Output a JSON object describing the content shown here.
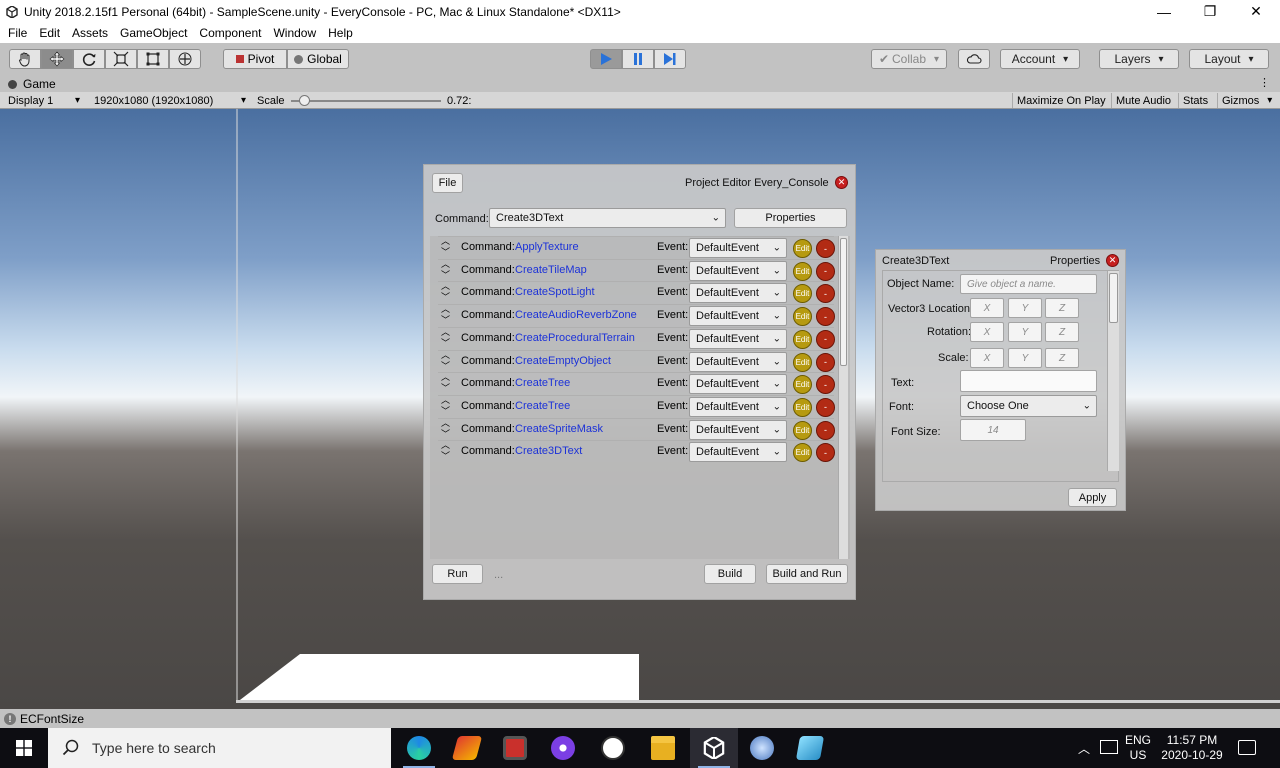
{
  "window": {
    "title": "Unity 2018.2.15f1 Personal (64bit) - SampleScene.unity - EveryConsole - PC, Mac & Linux Standalone* <DX11>",
    "minimize": "—",
    "maximize": "❐",
    "close": "✕"
  },
  "menubar": [
    "File",
    "Edit",
    "Assets",
    "GameObject",
    "Component",
    "Window",
    "Help"
  ],
  "toolbar": {
    "pivot": "Pivot",
    "global": "Global",
    "collab": "Collab",
    "account": "Account",
    "layers": "Layers",
    "layout": "Layout"
  },
  "game": {
    "tab": "Game",
    "display": "Display 1",
    "resolution": "1920x1080 (1920x1080)",
    "scale_label": "Scale",
    "scale_value": "0.72:",
    "scale_level": 0.05,
    "maximize_on_play": "Maximize On Play",
    "mute_audio": "Mute Audio",
    "stats": "Stats",
    "gizmos": "Gizmos"
  },
  "editor": {
    "file_button": "File",
    "title": "Project Editor Every_Console",
    "command_label": "Command:",
    "command_selected": "Create3DText",
    "properties_button": "Properties",
    "row_command_label": "Command:",
    "row_event_label": "Event:",
    "edit_label": "Edit",
    "delete_label": "-",
    "rows": [
      {
        "command": "ApplyTexture",
        "event": "DefaultEvent"
      },
      {
        "command": "CreateTileMap",
        "event": "DefaultEvent"
      },
      {
        "command": "CreateSpotLight",
        "event": "DefaultEvent"
      },
      {
        "command": "CreateAudioReverbZone",
        "event": "DefaultEvent"
      },
      {
        "command": "CreateProceduralTerrain",
        "event": "DefaultEvent"
      },
      {
        "command": "CreateEmptyObject",
        "event": "DefaultEvent"
      },
      {
        "command": "CreateTree",
        "event": "DefaultEvent"
      },
      {
        "command": "CreateTree",
        "event": "DefaultEvent"
      },
      {
        "command": "CreateSpriteMask",
        "event": "DefaultEvent"
      },
      {
        "command": "Create3DText",
        "event": "DefaultEvent"
      }
    ],
    "run_button": "Run",
    "ellipsis": "...",
    "build_button": "Build",
    "build_and_run_button": "Build and Run"
  },
  "properties": {
    "title": "Create3DText",
    "header": "Properties",
    "object_name_label": "Object Name:",
    "object_name_placeholder": "Give object a name.",
    "location_label": "Vector3 Location:",
    "rotation_label": "Rotation:",
    "scale_label": "Scale:",
    "x": "X",
    "y": "Y",
    "z": "Z",
    "text_label": "Text:",
    "font_label": "Font:",
    "font_value": "Choose One",
    "font_size_label": "Font Size:",
    "font_size_placeholder": "14",
    "apply_button": "Apply"
  },
  "status": {
    "message": "ECFontSize"
  },
  "taskbar": {
    "search_placeholder": "Type here to search",
    "lang_top": "ENG",
    "lang_bottom": "US",
    "time": "11:57 PM",
    "date": "2020-10-29"
  },
  "colors": {
    "accent_blue": "#1c32d8",
    "edit_gold": "#b69a10",
    "delete_red": "#b22b14",
    "close_red": "#c62020",
    "play_blue": "#2a72d8"
  }
}
